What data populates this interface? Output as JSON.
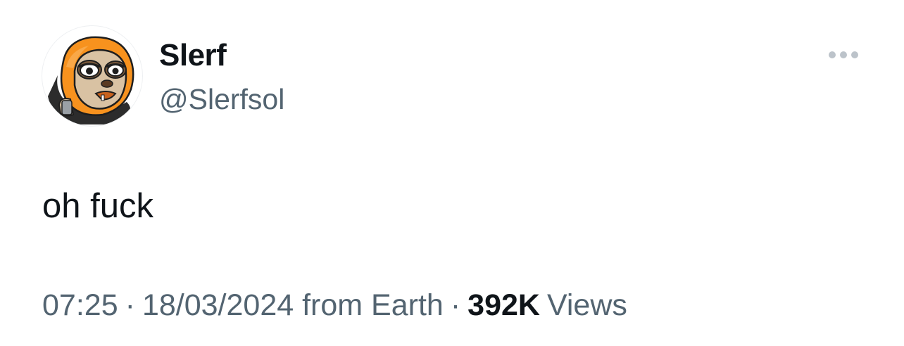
{
  "author": {
    "display_name": "Slerf",
    "handle": "@Slerfsol",
    "avatar_icon": "sloth-hoodie-avatar-icon"
  },
  "menu": {
    "icon": "more-horizontal-icon"
  },
  "tweet": {
    "text": "oh fuck"
  },
  "meta": {
    "time": "07:25",
    "separator": "·",
    "date": "18/03/2024",
    "source": "from Earth",
    "views_count": "392K",
    "views_label": "Views"
  },
  "colors": {
    "text_primary": "#0f1419",
    "text_secondary": "#536471",
    "avatar_hood": "#f7921e",
    "avatar_dark": "#2c2c2c"
  }
}
